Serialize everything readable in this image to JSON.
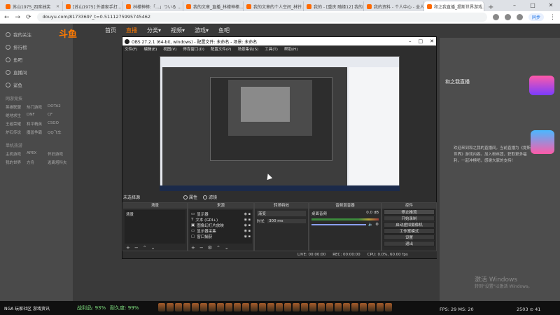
{
  "browser": {
    "tabs": [
      {
        "title": "苏山1975_四席抽奖"
      },
      {
        "title": "[苏山1975] 外婆家手打..."
      },
      {
        "title": "林檬神棒:「...」ついる ..."
      },
      {
        "title": "我的文章_直播_林檬神棒..."
      },
      {
        "title": "我的文章的个人空间_林钤..."
      },
      {
        "title": "我的 - [重庆 随缘12] 我的..."
      },
      {
        "title": "我的资料 - 个人中心 - 全人..."
      },
      {
        "title": "和之我直播_提斯世界游戏..."
      }
    ],
    "active_tab": 7,
    "url": "douyu.com/8173369?_t=0.5111275995745462",
    "sync_label": "同步",
    "window_buttons": [
      "–",
      "□",
      "✕"
    ]
  },
  "douyu": {
    "logo": "斗鱼",
    "top_nav": [
      "首页",
      "直播",
      "分类▾",
      "视频▾",
      "游戏▾",
      "鱼吧"
    ],
    "active_top_nav": 1,
    "left_nav": [
      "我的关注",
      "排行榜",
      "鱼吧",
      "直播间",
      "鲨鱼"
    ],
    "section_hot": "网游竞技",
    "grid_hot": [
      "英雄联盟",
      "热门游戏",
      "DOTA2",
      "绝地求生",
      "DNF",
      "CF",
      "王者荣耀",
      "和平精英",
      "CSGO",
      "炉石传说",
      "魔兽争霸",
      "QQ飞车"
    ],
    "section_more": "单机热游",
    "grid_more": [
      "主机游戏",
      "APEX",
      "怀旧游戏",
      "我的世界",
      "方舟",
      "逃离塔科夫"
    ],
    "right_title": "和之我直播",
    "right_text": "欢迎来到和之我的直播间，当前直播为《提斯世界》游戏内容。加入粉丝团，获取更多福利，一起冲榜吧，感谢大家的支持！",
    "activate": "激活 Windows",
    "activate_sub": "转到\"设置\"以激活 Windows。"
  },
  "obs": {
    "title": "OBS 27.2.1 (64-bit, windows) - 配置文件: 未命名 - 场景: 未命名",
    "menu": [
      "文件(F)",
      "编辑(E)",
      "视图(V)",
      "停靠窗口(D)",
      "配置文件(P)",
      "场景集合(S)",
      "工具(T)",
      "帮助(H)"
    ],
    "source_label": "未选择源",
    "props_label": "属性",
    "filters_label": "滤镜",
    "docks": {
      "scenes": {
        "title": "场景",
        "items": [
          "场景"
        ]
      },
      "sources": {
        "title": "来源",
        "items": [
          "显示器",
          "文本 (GDI+)",
          "图像幻灯片放映",
          "显示器采集",
          "窗口捕获"
        ]
      },
      "transitions": {
        "title": "转场特效",
        "type": "渐变",
        "duration_label": "时长",
        "duration": "300 ms"
      },
      "mixer": {
        "title": "音频混音器",
        "track": "桌面音频",
        "level": "0.0 dB"
      },
      "controls": {
        "title": "控件",
        "buttons": [
          "停止推流",
          "开始录制",
          "启动虚拟摄像机",
          "工作室模式",
          "设置",
          "退出"
        ]
      }
    },
    "status": {
      "live": "LIVE: 00:00:00",
      "rec": "REC: 00:00:00",
      "cpu": "CPU: 0.0%, 60.00 fps"
    }
  },
  "taskbar": {
    "news": "NGA 玩家社区 游戏资讯",
    "game_label": "战利品: 93%",
    "game_label2": "耐久度: 99%",
    "fps": "FPS: 29  MS: 20",
    "time": "2503 ⊙ 41"
  },
  "colors": {
    "accent": "#ff7a00",
    "obs_bg": "#2e2e2e"
  }
}
